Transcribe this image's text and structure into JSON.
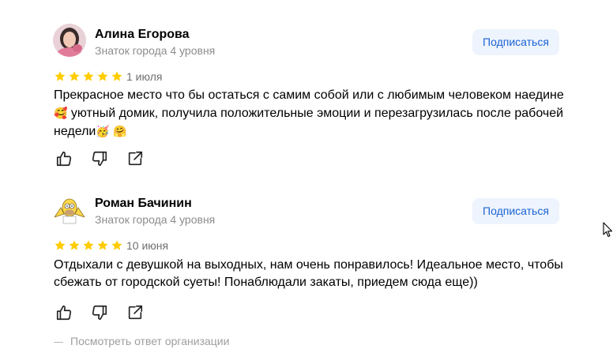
{
  "reviews": [
    {
      "author": "Алина Егорова",
      "level": "Знаток города 4 уровня",
      "subscribe_label": "Подписаться",
      "rating": 5,
      "date": "1 июля",
      "text_parts": [
        "Прекрасное место что бы остаться с самим собой или с любимым человеком наедине",
        "🥰",
        " уютный домик, получила положительные эмоции и перезагрузилась после рабочей недели",
        "🥳",
        " ",
        "🤗"
      ]
    },
    {
      "author": "Роман Бачинин",
      "level": "Знаток города 4 уровня",
      "subscribe_label": "Подписаться",
      "rating": 5,
      "date": "10 июня",
      "text": "Отдыхали с девушкой на выходных, нам очень понравилось! Идеальное место, чтобы сбежать от городской суеты! Понаблюдали закаты, приедем сюда еще))"
    }
  ],
  "org_reply_label": "Посмотреть ответ организации",
  "colors": {
    "star": "#ffcc00",
    "subscribe_bg": "#eef4fd",
    "subscribe_text": "#1b63d4",
    "muted_text": "#8c8c8c"
  },
  "icons": [
    "like-icon",
    "dislike-icon",
    "share-icon",
    "star-icon",
    "cursor-icon"
  ]
}
